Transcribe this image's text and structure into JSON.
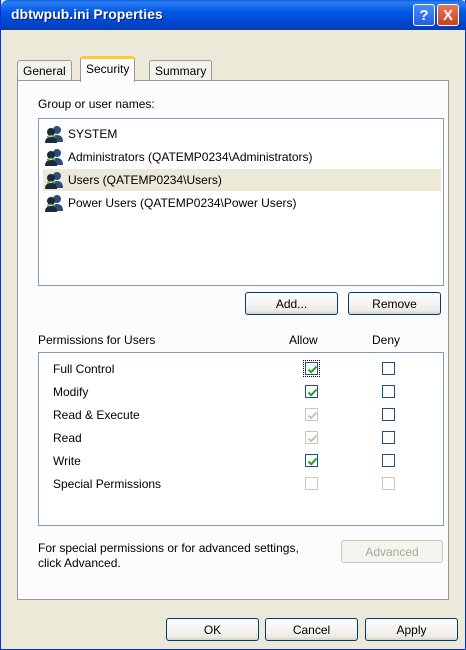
{
  "window": {
    "title": "dbtwpub.ini Properties"
  },
  "titlebar_buttons": {
    "help": "?",
    "close": "X"
  },
  "tabs": [
    {
      "label": "General"
    },
    {
      "label": "Security"
    },
    {
      "label": "Summary"
    }
  ],
  "active_tab": "Security",
  "groups": {
    "label": "Group or user names:",
    "items": [
      {
        "name": "SYSTEM",
        "selected": false
      },
      {
        "name": "Administrators (QATEMP0234\\Administrators)",
        "selected": false
      },
      {
        "name": "Users (QATEMP0234\\Users)",
        "selected": true
      },
      {
        "name": "Power Users (QATEMP0234\\Power Users)",
        "selected": false
      }
    ]
  },
  "buttons": {
    "add": "Add...",
    "remove": "Remove",
    "advanced": "Advanced",
    "ok": "OK",
    "cancel": "Cancel",
    "apply": "Apply"
  },
  "permissions": {
    "label": "Permissions for Users",
    "allow_header": "Allow",
    "deny_header": "Deny",
    "rows": [
      {
        "name": "Full Control",
        "allow": true,
        "allow_disabled": false,
        "deny": false,
        "deny_disabled": false
      },
      {
        "name": "Modify",
        "allow": true,
        "allow_disabled": false,
        "deny": false,
        "deny_disabled": false
      },
      {
        "name": "Read & Execute",
        "allow": true,
        "allow_disabled": true,
        "deny": false,
        "deny_disabled": false
      },
      {
        "name": "Read",
        "allow": true,
        "allow_disabled": true,
        "deny": false,
        "deny_disabled": false
      },
      {
        "name": "Write",
        "allow": true,
        "allow_disabled": false,
        "deny": false,
        "deny_disabled": false
      },
      {
        "name": "Special Permissions",
        "allow": false,
        "allow_disabled": true,
        "deny": false,
        "deny_disabled": true
      }
    ]
  },
  "advanced_note": {
    "line1": "For special permissions or for advanced settings,",
    "line2": "click Advanced."
  },
  "colors": {
    "titlebar": "#0054e3",
    "check": "#21a121",
    "check_disabled": "#c4c2b4",
    "window_bg": "#ece9d8"
  },
  "icons": {
    "user": "users-group-icon",
    "help": "help-icon",
    "close": "close-icon"
  }
}
